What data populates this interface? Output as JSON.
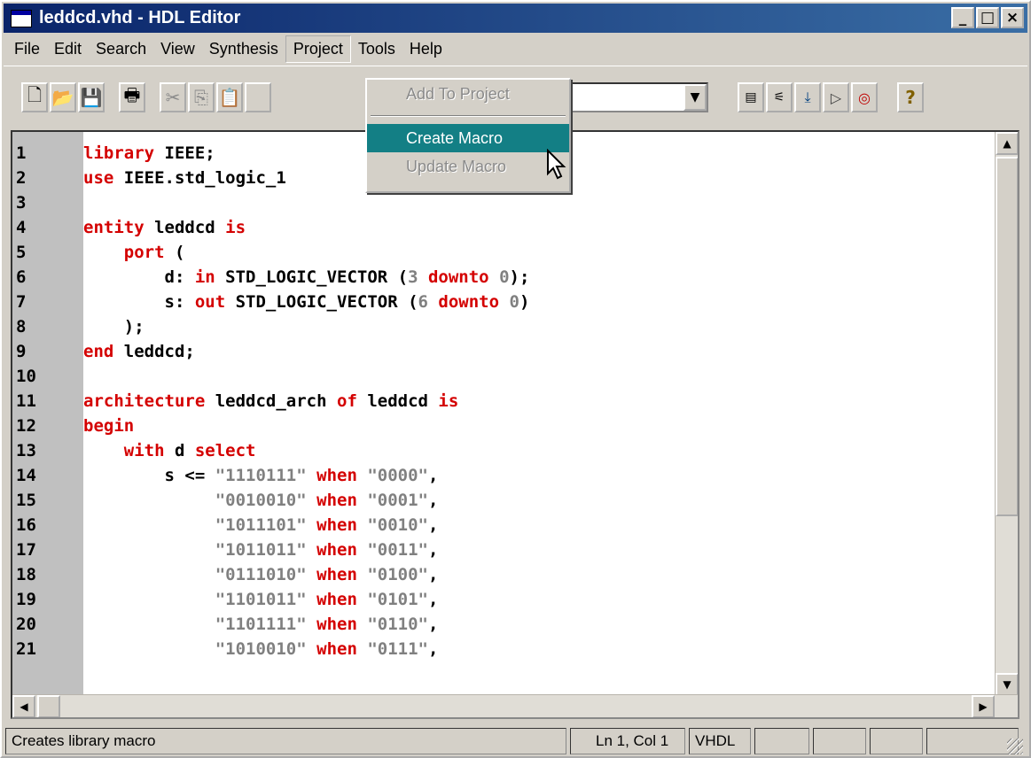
{
  "window": {
    "title": "leddcd.vhd - HDL Editor",
    "min": "_",
    "max": "□",
    "close": "×"
  },
  "menubar": {
    "items": [
      "File",
      "Edit",
      "Search",
      "View",
      "Synthesis",
      "Project",
      "Tools",
      "Help"
    ]
  },
  "project_menu": {
    "items": [
      "Add To Project",
      "Create Macro",
      "Update Macro"
    ]
  },
  "editor": {
    "lines": [
      {
        "n": "1",
        "segs": [
          [
            "kw",
            "library"
          ],
          [
            "id",
            " IEEE;"
          ]
        ]
      },
      {
        "n": "2",
        "segs": [
          [
            "kw",
            "use"
          ],
          [
            "id",
            " IEEE.std_logic_1"
          ]
        ]
      },
      {
        "n": "3",
        "segs": []
      },
      {
        "n": "4",
        "segs": [
          [
            "kw",
            "entity"
          ],
          [
            "id",
            " leddcd "
          ],
          [
            "kw",
            "is"
          ]
        ]
      },
      {
        "n": "5",
        "segs": [
          [
            "id",
            "    "
          ],
          [
            "kw",
            "port"
          ],
          [
            "id",
            " ("
          ]
        ]
      },
      {
        "n": "6",
        "segs": [
          [
            "id",
            "        d: "
          ],
          [
            "kw",
            "in"
          ],
          [
            "id",
            " STD_LOGIC_VECTOR ("
          ],
          [
            "num",
            "3"
          ],
          [
            "id",
            " "
          ],
          [
            "kw",
            "downto"
          ],
          [
            "id",
            " "
          ],
          [
            "num",
            "0"
          ],
          [
            "id",
            ");"
          ]
        ]
      },
      {
        "n": "7",
        "segs": [
          [
            "id",
            "        s: "
          ],
          [
            "kw",
            "out"
          ],
          [
            "id",
            " STD_LOGIC_VECTOR ("
          ],
          [
            "num",
            "6"
          ],
          [
            "id",
            " "
          ],
          [
            "kw",
            "downto"
          ],
          [
            "id",
            " "
          ],
          [
            "num",
            "0"
          ],
          [
            "id",
            ")"
          ]
        ]
      },
      {
        "n": "8",
        "segs": [
          [
            "id",
            "    );"
          ]
        ]
      },
      {
        "n": "9",
        "segs": [
          [
            "kw",
            "end"
          ],
          [
            "id",
            " leddcd;"
          ]
        ]
      },
      {
        "n": "10",
        "segs": []
      },
      {
        "n": "11",
        "segs": [
          [
            "kw",
            "architecture"
          ],
          [
            "id",
            " leddcd_arch "
          ],
          [
            "kw",
            "of"
          ],
          [
            "id",
            " leddcd "
          ],
          [
            "kw",
            "is"
          ]
        ]
      },
      {
        "n": "12",
        "segs": [
          [
            "kw",
            "begin"
          ]
        ]
      },
      {
        "n": "13",
        "segs": [
          [
            "id",
            "    "
          ],
          [
            "kw",
            "with"
          ],
          [
            "id",
            " d "
          ],
          [
            "kw",
            "select"
          ]
        ]
      },
      {
        "n": "14",
        "segs": [
          [
            "id",
            "        s <= "
          ],
          [
            "num",
            "\"1110111\""
          ],
          [
            "id",
            " "
          ],
          [
            "kw",
            "when"
          ],
          [
            "id",
            " "
          ],
          [
            "num",
            "\"0000\""
          ],
          [
            "id",
            ","
          ]
        ]
      },
      {
        "n": "15",
        "segs": [
          [
            "id",
            "             "
          ],
          [
            "num",
            "\"0010010\""
          ],
          [
            "id",
            " "
          ],
          [
            "kw",
            "when"
          ],
          [
            "id",
            " "
          ],
          [
            "num",
            "\"0001\""
          ],
          [
            "id",
            ","
          ]
        ]
      },
      {
        "n": "16",
        "segs": [
          [
            "id",
            "             "
          ],
          [
            "num",
            "\"1011101\""
          ],
          [
            "id",
            " "
          ],
          [
            "kw",
            "when"
          ],
          [
            "id",
            " "
          ],
          [
            "num",
            "\"0010\""
          ],
          [
            "id",
            ","
          ]
        ]
      },
      {
        "n": "17",
        "segs": [
          [
            "id",
            "             "
          ],
          [
            "num",
            "\"1011011\""
          ],
          [
            "id",
            " "
          ],
          [
            "kw",
            "when"
          ],
          [
            "id",
            " "
          ],
          [
            "num",
            "\"0011\""
          ],
          [
            "id",
            ","
          ]
        ]
      },
      {
        "n": "18",
        "segs": [
          [
            "id",
            "             "
          ],
          [
            "num",
            "\"0111010\""
          ],
          [
            "id",
            " "
          ],
          [
            "kw",
            "when"
          ],
          [
            "id",
            " "
          ],
          [
            "num",
            "\"0100\""
          ],
          [
            "id",
            ","
          ]
        ]
      },
      {
        "n": "19",
        "segs": [
          [
            "id",
            "             "
          ],
          [
            "num",
            "\"1101011\""
          ],
          [
            "id",
            " "
          ],
          [
            "kw",
            "when"
          ],
          [
            "id",
            " "
          ],
          [
            "num",
            "\"0101\""
          ],
          [
            "id",
            ","
          ]
        ]
      },
      {
        "n": "20",
        "segs": [
          [
            "id",
            "             "
          ],
          [
            "num",
            "\"1101111\""
          ],
          [
            "id",
            " "
          ],
          [
            "kw",
            "when"
          ],
          [
            "id",
            " "
          ],
          [
            "num",
            "\"0110\""
          ],
          [
            "id",
            ","
          ]
        ]
      },
      {
        "n": "21",
        "segs": [
          [
            "id",
            "             "
          ],
          [
            "num",
            "\"1010010\""
          ],
          [
            "id",
            " "
          ],
          [
            "kw",
            "when"
          ],
          [
            "id",
            " "
          ],
          [
            "num",
            "\"0111\""
          ],
          [
            "id",
            ","
          ]
        ]
      }
    ]
  },
  "statusbar": {
    "message": "Creates library macro",
    "position": "Ln 1, Col 1",
    "language": "VHDL"
  },
  "colors": {
    "keyword": "#d40000",
    "number": "#808080",
    "title_start": "#0a246a",
    "title_end": "#3a6ea5",
    "menu_select": "#137f85"
  },
  "icons": [
    "new-file-icon",
    "open-folder-icon",
    "save-icon",
    "print-icon",
    "cut-icon",
    "copy-icon",
    "paste-icon",
    "synthesis-icon",
    "check-syntax-icon",
    "implementation-icon",
    "gate-icon",
    "probe-icon",
    "help-icon"
  ]
}
